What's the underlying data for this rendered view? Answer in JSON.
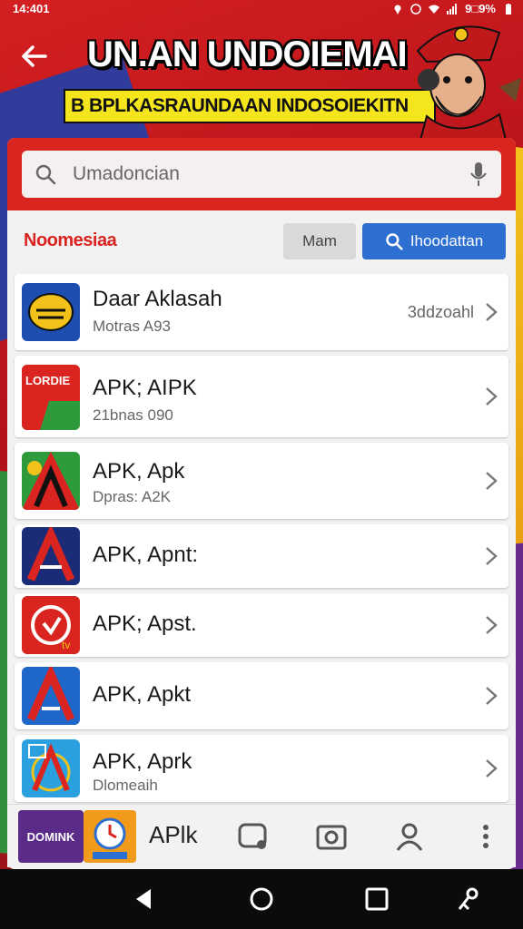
{
  "status_bar": {
    "time": "14:401",
    "battery": "9□9%"
  },
  "header": {
    "title": "UN.AN UNDOIEMAI",
    "subtitle": "B BPLKASRAUNDAAN INDOSOIEKITN"
  },
  "search": {
    "placeholder": "Umadoncian"
  },
  "filter": {
    "label": "Noomesiaa",
    "button_gray": "Mam",
    "button_blue": "Ihoodattan"
  },
  "apps": [
    {
      "name": "Daar Aklasah",
      "sub": "Motras A93",
      "meta": "3ddzoahl",
      "icon": "yellow-badge-icon"
    },
    {
      "name": "APK; AIPK",
      "sub": "21bnas 090",
      "meta": "",
      "icon": "red-green-logo-icon"
    },
    {
      "name": "APK, Apk",
      "sub": "Dpras: A2K",
      "meta": "",
      "icon": "tricolor-a-icon"
    },
    {
      "name": "APK, Apnt:",
      "sub": "",
      "meta": "",
      "icon": "blue-red-a-icon"
    },
    {
      "name": "APK; Apst.",
      "sub": "",
      "meta": "",
      "icon": "red-circle-tv-icon"
    },
    {
      "name": "APK, Apkt",
      "sub": "",
      "meta": "",
      "icon": "blue-a-icon"
    },
    {
      "name": "APK, Aprk",
      "sub": "Dlomeaih",
      "meta": "",
      "icon": "globe-a-icon"
    }
  ],
  "bottom_bar": {
    "tile_label": "DOMINK",
    "app_label": "APlk"
  },
  "colors": {
    "accent_red": "#d9241f",
    "accent_blue": "#2c6fd0",
    "banner_yellow": "#f5e51c"
  }
}
